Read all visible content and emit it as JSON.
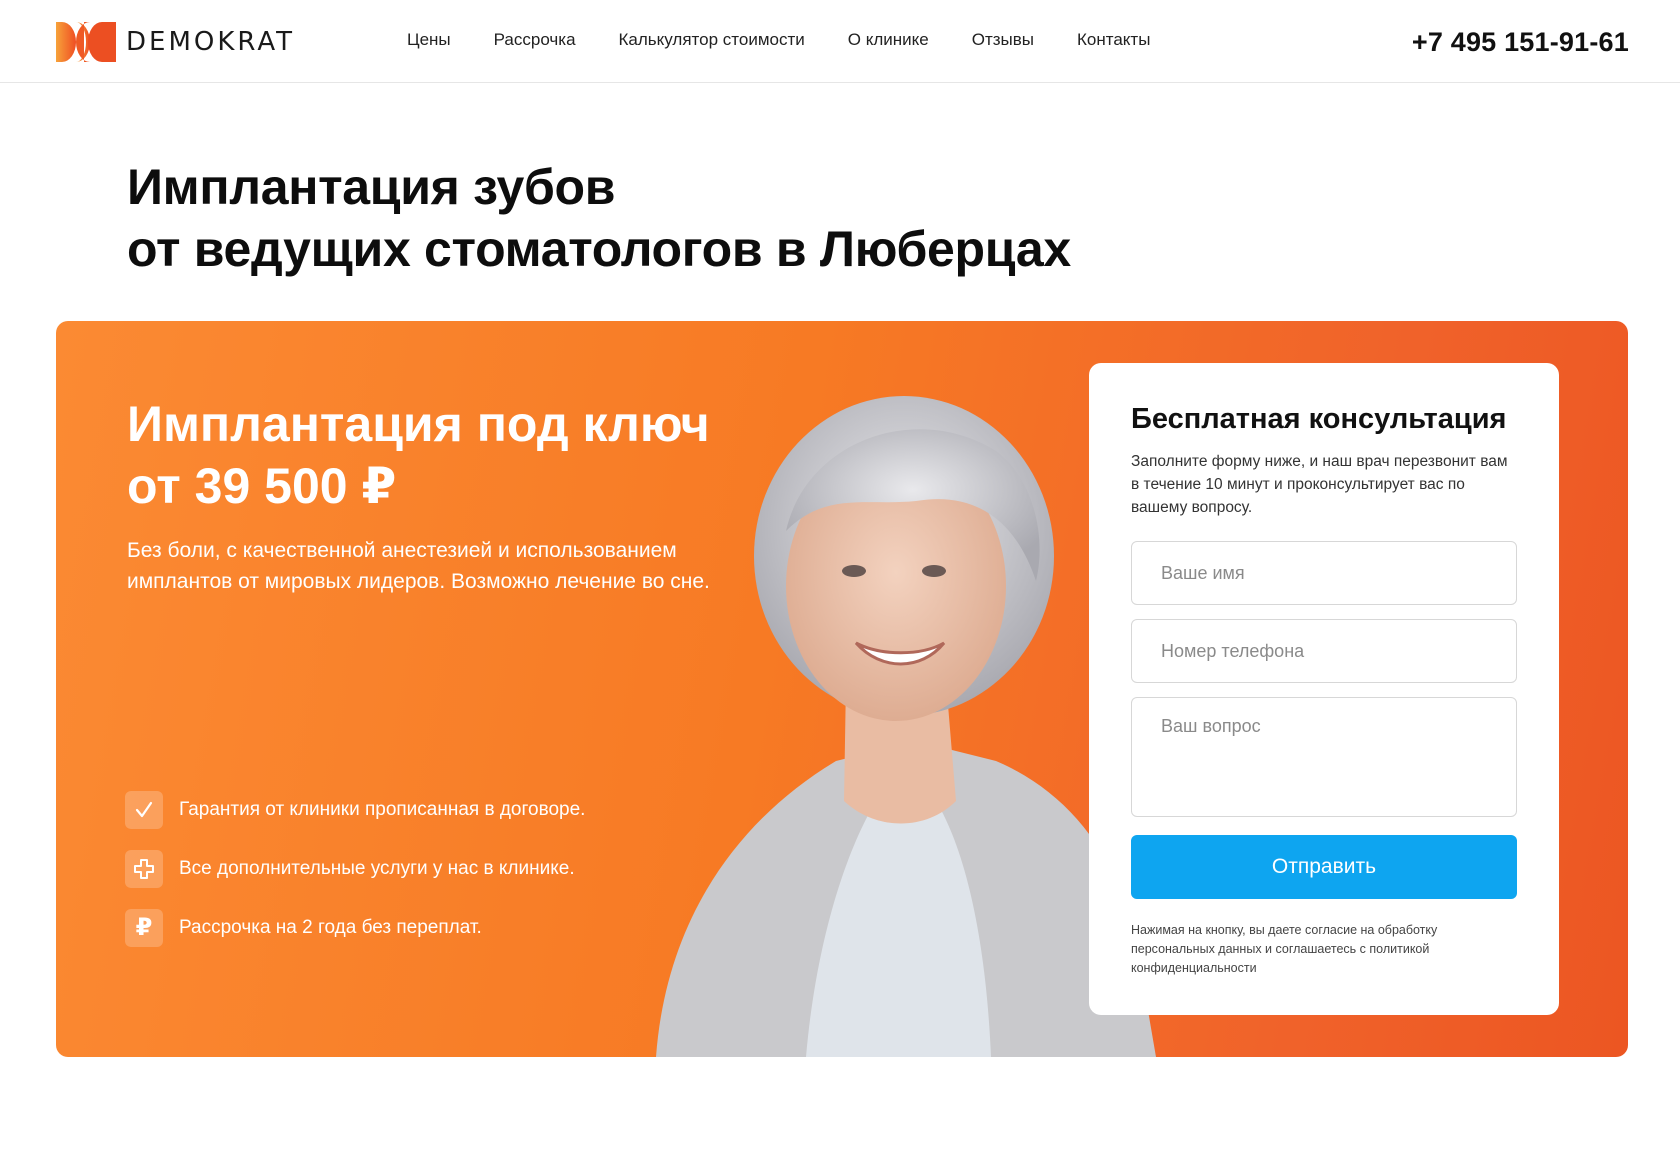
{
  "brand": {
    "name": "DEMOKRAT",
    "accent": "#f77a24",
    "button_color": "#0ea5f0"
  },
  "nav": {
    "items": [
      {
        "label": "Цены"
      },
      {
        "label": "Рассрочка"
      },
      {
        "label": "Калькулятор стоимости"
      },
      {
        "label": "О клинике"
      },
      {
        "label": "Отзывы"
      },
      {
        "label": "Контакты"
      }
    ]
  },
  "header": {
    "phone": "+7 495 151-91-61"
  },
  "headline": {
    "line1": "Имплантация зубов",
    "line2": "от ведущих стоматологов в Люберцах"
  },
  "hero": {
    "title_line1": "Имплантация под ключ",
    "title_line2": "от 39 500 ₽",
    "subtitle": "Без боли, с качественной анестезией и использованием имплантов от мировых лидеров. Возможно лечение во сне.",
    "features": [
      {
        "icon": "check-icon",
        "text": "Гарантия от клиники прописанная в договоре."
      },
      {
        "icon": "plus-cross-icon",
        "text": "Все дополнительные услуги у нас в клинике."
      },
      {
        "icon": "ruble-icon",
        "glyph": "₽",
        "text": "Рассрочка на 2 года без переплат."
      }
    ]
  },
  "form": {
    "title": "Бесплатная консультация",
    "description": "Заполните форму ниже, и наш врач перезвонит вам в течение 10 минут и проконсультирует вас по вашему вопросу.",
    "name_placeholder": "Ваше имя",
    "phone_placeholder": "Номер телефона",
    "question_placeholder": "Ваш вопрос",
    "submit_label": "Отправить",
    "legal": "Нажимая на кнопку, вы даете согласие на обработку персональных данных и соглашаетесь с политикой конфиденциальности"
  }
}
